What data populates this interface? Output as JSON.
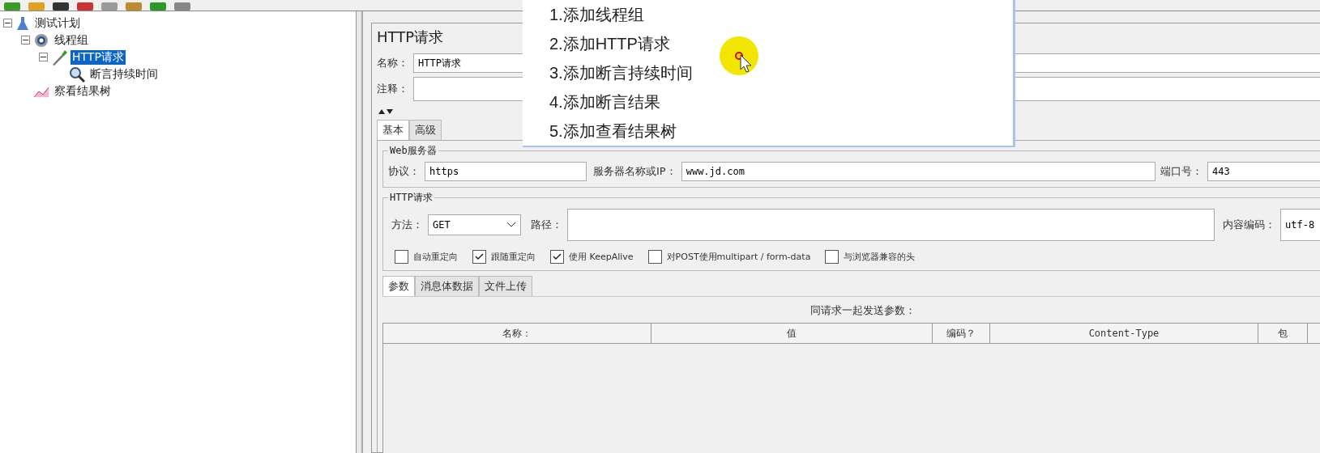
{
  "tree": [
    {
      "label": "测试计划",
      "kind": "plan",
      "expanded": true,
      "selected": false,
      "children": [
        {
          "label": "线程组",
          "kind": "gear",
          "expanded": true,
          "selected": false,
          "children": [
            {
              "label": "HTTP请求",
              "kind": "pipette",
              "expanded": true,
              "selected": true,
              "children": [
                {
                  "label": "断言持续时间",
                  "kind": "magnifier",
                  "selected": false
                }
              ]
            }
          ]
        },
        {
          "label": "察看结果树",
          "kind": "chart",
          "selected": false
        }
      ]
    }
  ],
  "panel": {
    "title": "HTTP请求",
    "name": {
      "label": "名称：",
      "value": "HTTP请求"
    },
    "comment": {
      "label": "注释："
    },
    "tabs": [
      {
        "label": "基本",
        "selected": true
      },
      {
        "label": "高级",
        "selected": false
      }
    ],
    "web_server": {
      "legend": "Web服务器",
      "protocol": {
        "label": "协议：",
        "value": "https"
      },
      "server": {
        "label": "服务器名称或IP：",
        "value": "www.jd.com"
      },
      "port": {
        "label": "端口号：",
        "value": "443"
      }
    },
    "http_request": {
      "legend": "HTTP请求",
      "method": {
        "label": "方法：",
        "value": "GET"
      },
      "path": {
        "label": "路径："
      },
      "encoding": {
        "label": "内容编码：",
        "value": "utf-8"
      },
      "options": [
        {
          "label": "自动重定向",
          "checked": false
        },
        {
          "label": "跟随重定向",
          "checked": true
        },
        {
          "label": "使用 KeepAlive",
          "checked": true
        },
        {
          "label": "对POST使用multipart / form-data",
          "checked": false
        },
        {
          "label": "与浏览器兼容的头",
          "checked": false
        }
      ]
    },
    "sub_tabs": [
      {
        "label": "参数",
        "selected": true
      },
      {
        "label": "消息体数据",
        "selected": false
      },
      {
        "label": "文件上传",
        "selected": false
      }
    ],
    "params_caption": "同请求一起发送参数：",
    "columns": [
      "名称：",
      "值",
      "编码？",
      "Content-Type",
      "包"
    ]
  },
  "overlay": {
    "steps": [
      "1.添加线程组",
      "2.添加HTTP请求",
      "3.添加断言持续时间",
      "4.添加断言结果",
      "5.添加查看结果树"
    ]
  }
}
